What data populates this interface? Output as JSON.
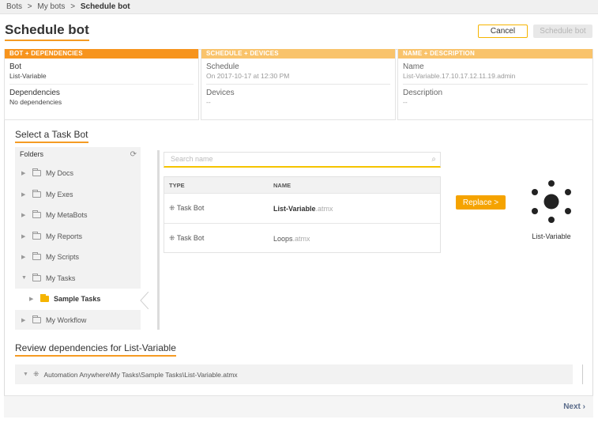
{
  "breadcrumb": {
    "items": [
      "Bots",
      ">",
      "My bots",
      ">"
    ],
    "current": "Schedule bot"
  },
  "page_title": "Schedule bot",
  "actions": {
    "cancel": "Cancel",
    "schedule": "Schedule bot"
  },
  "steps": {
    "bot": {
      "header": "BOT + DEPENDENCIES",
      "bot_label": "Bot",
      "bot_value": "List-Variable",
      "deps_label": "Dependencies",
      "deps_value": "No dependencies"
    },
    "schedule": {
      "header": "SCHEDULE + DEVICES",
      "schedule_label": "Schedule",
      "schedule_value": "On 2017-10-17 at 12:30 PM",
      "devices_label": "Devices",
      "devices_value": "--"
    },
    "name": {
      "header": "NAME + DESCRIPTION",
      "name_label": "Name",
      "name_value": "List-Variable.17.10.17.12.11.19.admin",
      "desc_label": "Description",
      "desc_value": "--"
    }
  },
  "select_section": {
    "title": "Select a Task Bot"
  },
  "folders": {
    "header": "Folders",
    "items": [
      {
        "label": "My Docs"
      },
      {
        "label": "My Exes"
      },
      {
        "label": "My MetaBots"
      },
      {
        "label": "My Reports"
      },
      {
        "label": "My Scripts"
      },
      {
        "label": "My Tasks"
      },
      {
        "label": "Sample Tasks"
      },
      {
        "label": "My Workflow"
      }
    ]
  },
  "search": {
    "placeholder": "Search name"
  },
  "table": {
    "headers": [
      "TYPE",
      "NAME"
    ],
    "rows": [
      {
        "type": "Task Bot",
        "name": "List-Variable",
        "ext": ".atmx"
      },
      {
        "type": "Task Bot",
        "name": "Loops",
        "ext": ".atmx"
      }
    ]
  },
  "replace_button": "Replace >",
  "selected_bot_name": "List-Variable",
  "deps_section": {
    "title": "Review dependencies for List-Variable",
    "path": "Automation Anywhere\\My Tasks\\Sample Tasks\\List-Variable.atmx"
  },
  "footer": {
    "next": "Next ›"
  },
  "colors": {
    "accent": "#f7941d",
    "accent_light": "#f9c36b",
    "button_yellow": "#f5a300"
  },
  "icons": {
    "refresh": "refresh-icon",
    "search": "search-icon",
    "task_bot": "task-bot-icon",
    "folder": "folder-icon"
  }
}
